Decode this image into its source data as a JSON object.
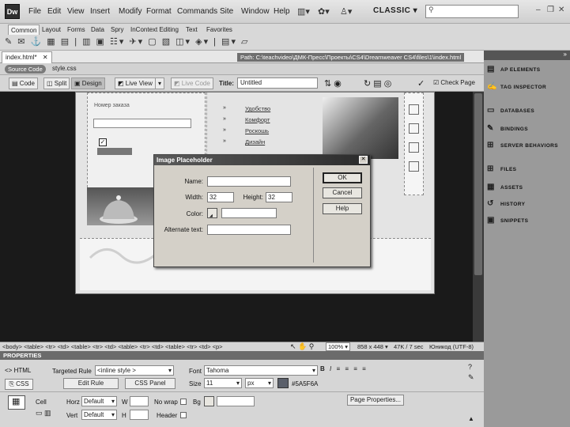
{
  "app": {
    "logo": "Dw",
    "workspace": "CLASSIC"
  },
  "menu": [
    "File",
    "Edit",
    "View",
    "Insert",
    "Modify",
    "Format",
    "Commands",
    "Site",
    "Window",
    "Help"
  ],
  "insert_tabs": [
    "Common",
    "Layout",
    "Forms",
    "Data",
    "Spry",
    "InContext Editing",
    "Text",
    "Favorites"
  ],
  "document": {
    "tab": "index.html*",
    "path": "Path: C:\\teachvideo\\ДМК-Пресс\\Проекты\\CS4\\Dreamweaver CS4\\files\\1\\index.html",
    "source_code": "Source Code",
    "related_file": "style.css"
  },
  "doc_toolbar": {
    "code": "Code",
    "split": "Split",
    "design": "Design",
    "live_view": "Live View",
    "live_code": "Live Code",
    "title_label": "Title:",
    "title_value": "Untitled",
    "check_page": "Check Page"
  },
  "page_content": {
    "order_label": "Номер заказа",
    "links": [
      "Удобство",
      "Комфорт",
      "Роскошь",
      "Дизайн"
    ]
  },
  "dialog": {
    "title": "Image Placeholder",
    "name_label": "Name:",
    "name_value": "",
    "width_label": "Width:",
    "width_value": "32",
    "height_label": "Height:",
    "height_value": "32",
    "color_label": "Color:",
    "alt_label": "Alternate text:",
    "alt_value": "",
    "ok": "OK",
    "cancel": "Cancel",
    "help": "Help"
  },
  "status_bar": {
    "tags": "<body> <table> <tr> <td> <table> <tr> <td> <table> <tr> <td> <table> <tr> <td> <p>",
    "zoom": "100%",
    "size": "858 x 448",
    "download": "47K / 7 sec",
    "encoding": "Юникод (UTF-8)"
  },
  "properties": {
    "header": "PROPERTIES",
    "html": "HTML",
    "css": "CSS",
    "targeted_rule_label": "Targeted Rule",
    "targeted_rule_value": "<inline style >",
    "edit_rule": "Edit Rule",
    "css_panel": "CSS Panel",
    "font_label": "Font",
    "font_value": "Tahoma",
    "size_label": "Size",
    "size_value": "11",
    "size_unit": "px",
    "color_value": "#5A5F6A",
    "cell_label": "Cell",
    "horz_label": "Horz",
    "horz_value": "Default",
    "vert_label": "Vert",
    "vert_value": "Default",
    "w_label": "W",
    "h_label": "H",
    "nowrap_label": "No wrap",
    "header_label": "Header",
    "bg_label": "Bg",
    "page_properties": "Page Properties..."
  },
  "panels": [
    "AP ELEMENTS",
    "TAG INSPECTOR",
    "DATABASES",
    "BINDINGS",
    "SERVER BEHAVIORS",
    "FILES",
    "ASSETS",
    "HISTORY",
    "SNIPPETS"
  ],
  "colors": {
    "text_color_swatch": "#5A5F6A"
  }
}
